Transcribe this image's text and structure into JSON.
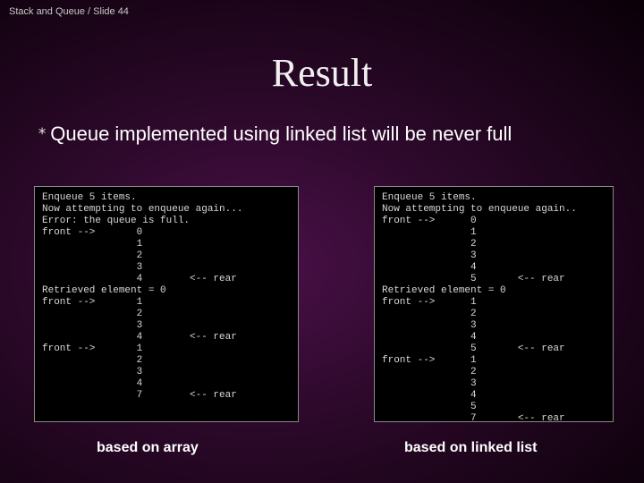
{
  "crumb": "Stack and Queue / Slide 44",
  "title": "Result",
  "bullet": "Queue implemented using linked list will be never full",
  "panel_left": "Enqueue 5 items.\nNow attempting to enqueue again...\nError: the queue is full.\nfront -->       0\n                1\n                2\n                3\n                4        <-- rear\nRetrieved element = 0\nfront -->       1\n                2\n                3\n                4        <-- rear\nfront -->       1\n                2\n                3\n                4\n                7        <-- rear",
  "panel_right": "Enqueue 5 items.\nNow attempting to enqueue again..\nfront -->      0\n               1\n               2\n               3\n               4\n               5       <-- rear\nRetrieved element = 0\nfront -->      1\n               2\n               3\n               4\n               5       <-- rear\nfront -->      1\n               2\n               3\n               4\n               5\n               7       <-- rear",
  "caption_left": "based on array",
  "caption_right": "based on linked list"
}
